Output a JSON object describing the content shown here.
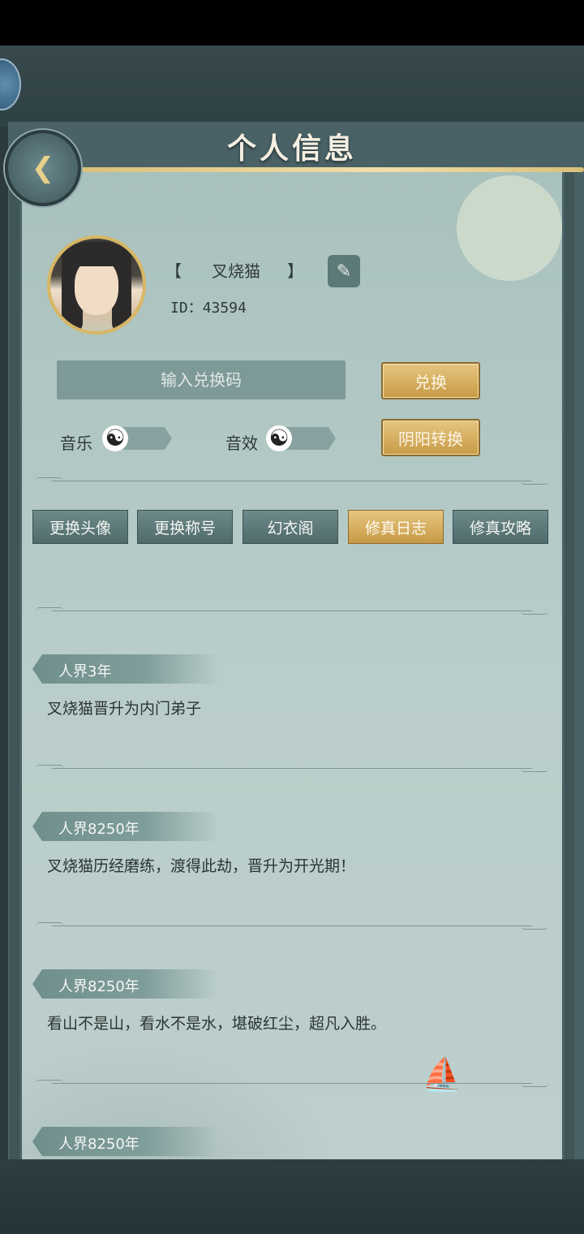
{
  "header": {
    "title": "个人信息",
    "back_icon": "back-arrow-icon"
  },
  "profile": {
    "name": "叉烧猫",
    "bracket_left": "【",
    "bracket_right": "】",
    "id_text": "ID：43594",
    "edit_icon": "brush-icon"
  },
  "redeem": {
    "placeholder": "输入兑换码",
    "button_label": "兑换"
  },
  "settings": {
    "music_label": "音乐",
    "sfx_label": "音效",
    "yinyang_button": "阴阳转换",
    "toggle_icon": "☯"
  },
  "tabs": [
    {
      "label": "更换头像",
      "active": false
    },
    {
      "label": "更换称号",
      "active": false
    },
    {
      "label": "幻衣阁",
      "active": false
    },
    {
      "label": "修真日志",
      "active": true
    },
    {
      "label": "修真攻略",
      "active": false
    }
  ],
  "log": [
    {
      "time": "人界3年",
      "text": "叉烧猫晋升为内门弟子"
    },
    {
      "time": "人界8250年",
      "text": "叉烧猫历经磨练，渡得此劫，晋升为开光期！"
    },
    {
      "time": "人界8250年",
      "text": "看山不是山，看水不是水，堪破红尘，超凡入胜。"
    },
    {
      "time": "人界8250年",
      "text": ""
    }
  ],
  "colors": {
    "gold_accent": "#d8b060",
    "panel_teal": "#a9c1bd",
    "dark_frame": "#2e4145"
  }
}
